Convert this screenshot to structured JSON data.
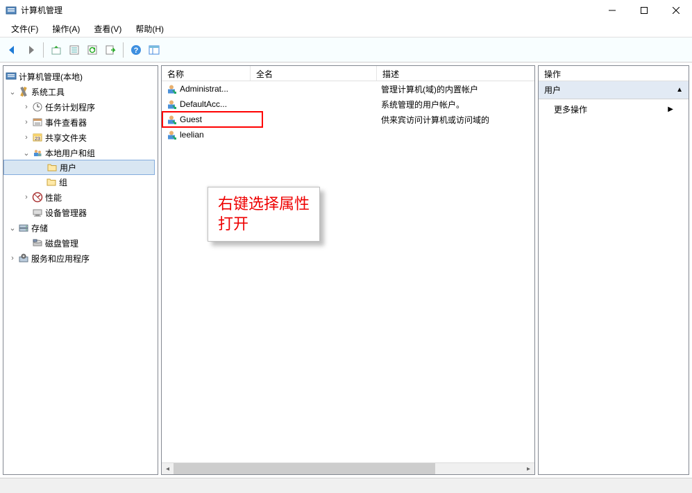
{
  "titlebar": {
    "title": "计算机管理"
  },
  "menubar": {
    "items": [
      "文件(F)",
      "操作(A)",
      "查看(V)",
      "帮助(H)"
    ]
  },
  "tree": {
    "root": "计算机管理(本地)",
    "system_tools": {
      "label": "系统工具",
      "children": {
        "task_scheduler": "任务计划程序",
        "event_viewer": "事件查看器",
        "shared_folders": "共享文件夹",
        "local_users_groups": {
          "label": "本地用户和组",
          "users": "用户",
          "groups": "组"
        },
        "performance": "性能",
        "device_manager": "设备管理器"
      }
    },
    "storage": {
      "label": "存储",
      "disk_mgmt": "磁盘管理"
    },
    "services_apps": "服务和应用程序"
  },
  "list": {
    "columns": {
      "name": "名称",
      "fullname": "全名",
      "description": "描述"
    },
    "rows": [
      {
        "name": "Administrat...",
        "fullname": "",
        "description": "管理计算机(域)的内置帐户"
      },
      {
        "name": "DefaultAcc...",
        "fullname": "",
        "description": "系统管理的用户帐户。"
      },
      {
        "name": "Guest",
        "fullname": "",
        "description": "供来宾访问计算机或访问域的"
      },
      {
        "name": "leelian",
        "fullname": "",
        "description": ""
      }
    ]
  },
  "actions": {
    "title": "操作",
    "group": "用户",
    "more": "更多操作"
  },
  "annotation": "右键选择属性打开",
  "colors": {
    "highlight": "#ff0000",
    "selection_bg": "#d8e6f2",
    "action_group_bg": "#e2eaf4"
  }
}
